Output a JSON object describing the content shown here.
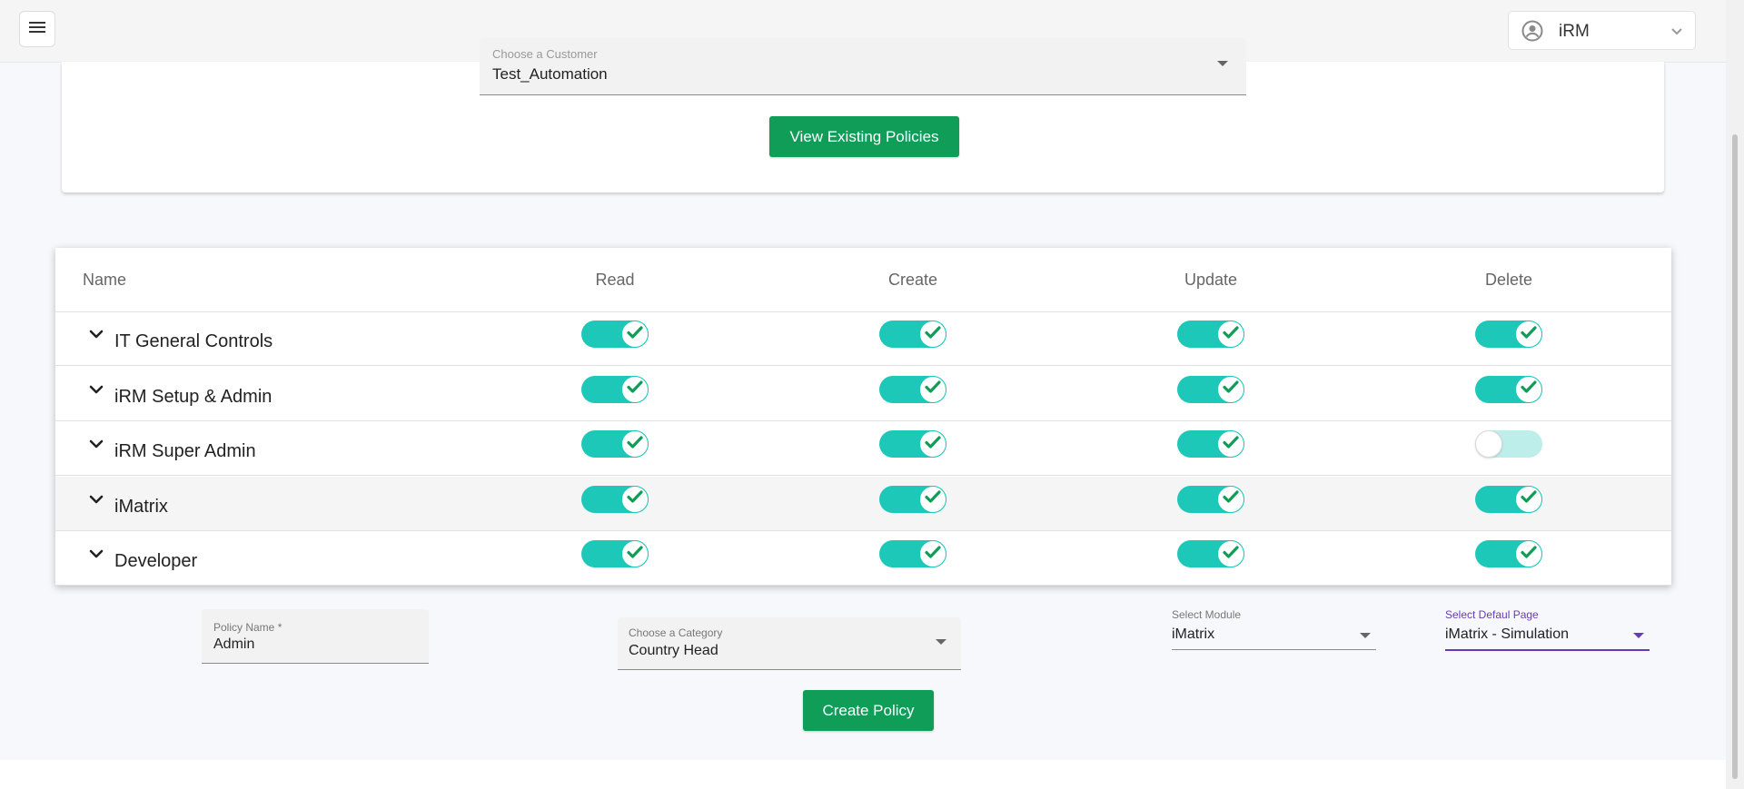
{
  "header": {
    "menu_icon": "hamburger-menu-icon",
    "user_menu": {
      "label": "iRM",
      "icon": "user-circle-icon",
      "chevron_icon": "chevron-down-icon"
    }
  },
  "customer": {
    "label": "Choose a Customer",
    "value": "Test_Automation",
    "view_button": "View Existing Policies"
  },
  "permissions_table": {
    "columns": [
      "Name",
      "Read",
      "Create",
      "Update",
      "Delete"
    ],
    "rows": [
      {
        "name": "IT General Controls",
        "read": true,
        "create": true,
        "update": true,
        "delete": true
      },
      {
        "name": "iRM Setup & Admin",
        "read": true,
        "create": true,
        "update": true,
        "delete": true
      },
      {
        "name": "iRM Super Admin",
        "read": true,
        "create": true,
        "update": true,
        "delete": false
      },
      {
        "name": "iMatrix",
        "read": true,
        "create": true,
        "update": true,
        "delete": true
      },
      {
        "name": "Developer",
        "read": true,
        "create": true,
        "update": true,
        "delete": true
      }
    ]
  },
  "form": {
    "policy_name": {
      "label": "Policy Name *",
      "value": "Admin"
    },
    "category": {
      "label": "Choose a Category",
      "value": "Country Head"
    },
    "module": {
      "label": "Select Module",
      "value": "iMatrix"
    },
    "default_page": {
      "label": "Select Defaul Page",
      "value": "iMatrix - Simulation"
    },
    "create_button": "Create Policy"
  },
  "colors": {
    "primary_green": "#0f9d58",
    "toggle_on": "#1ec8b9",
    "toggle_off": "#bdeeea",
    "check": "#0f9d58",
    "focus_purple": "#673ab7"
  }
}
